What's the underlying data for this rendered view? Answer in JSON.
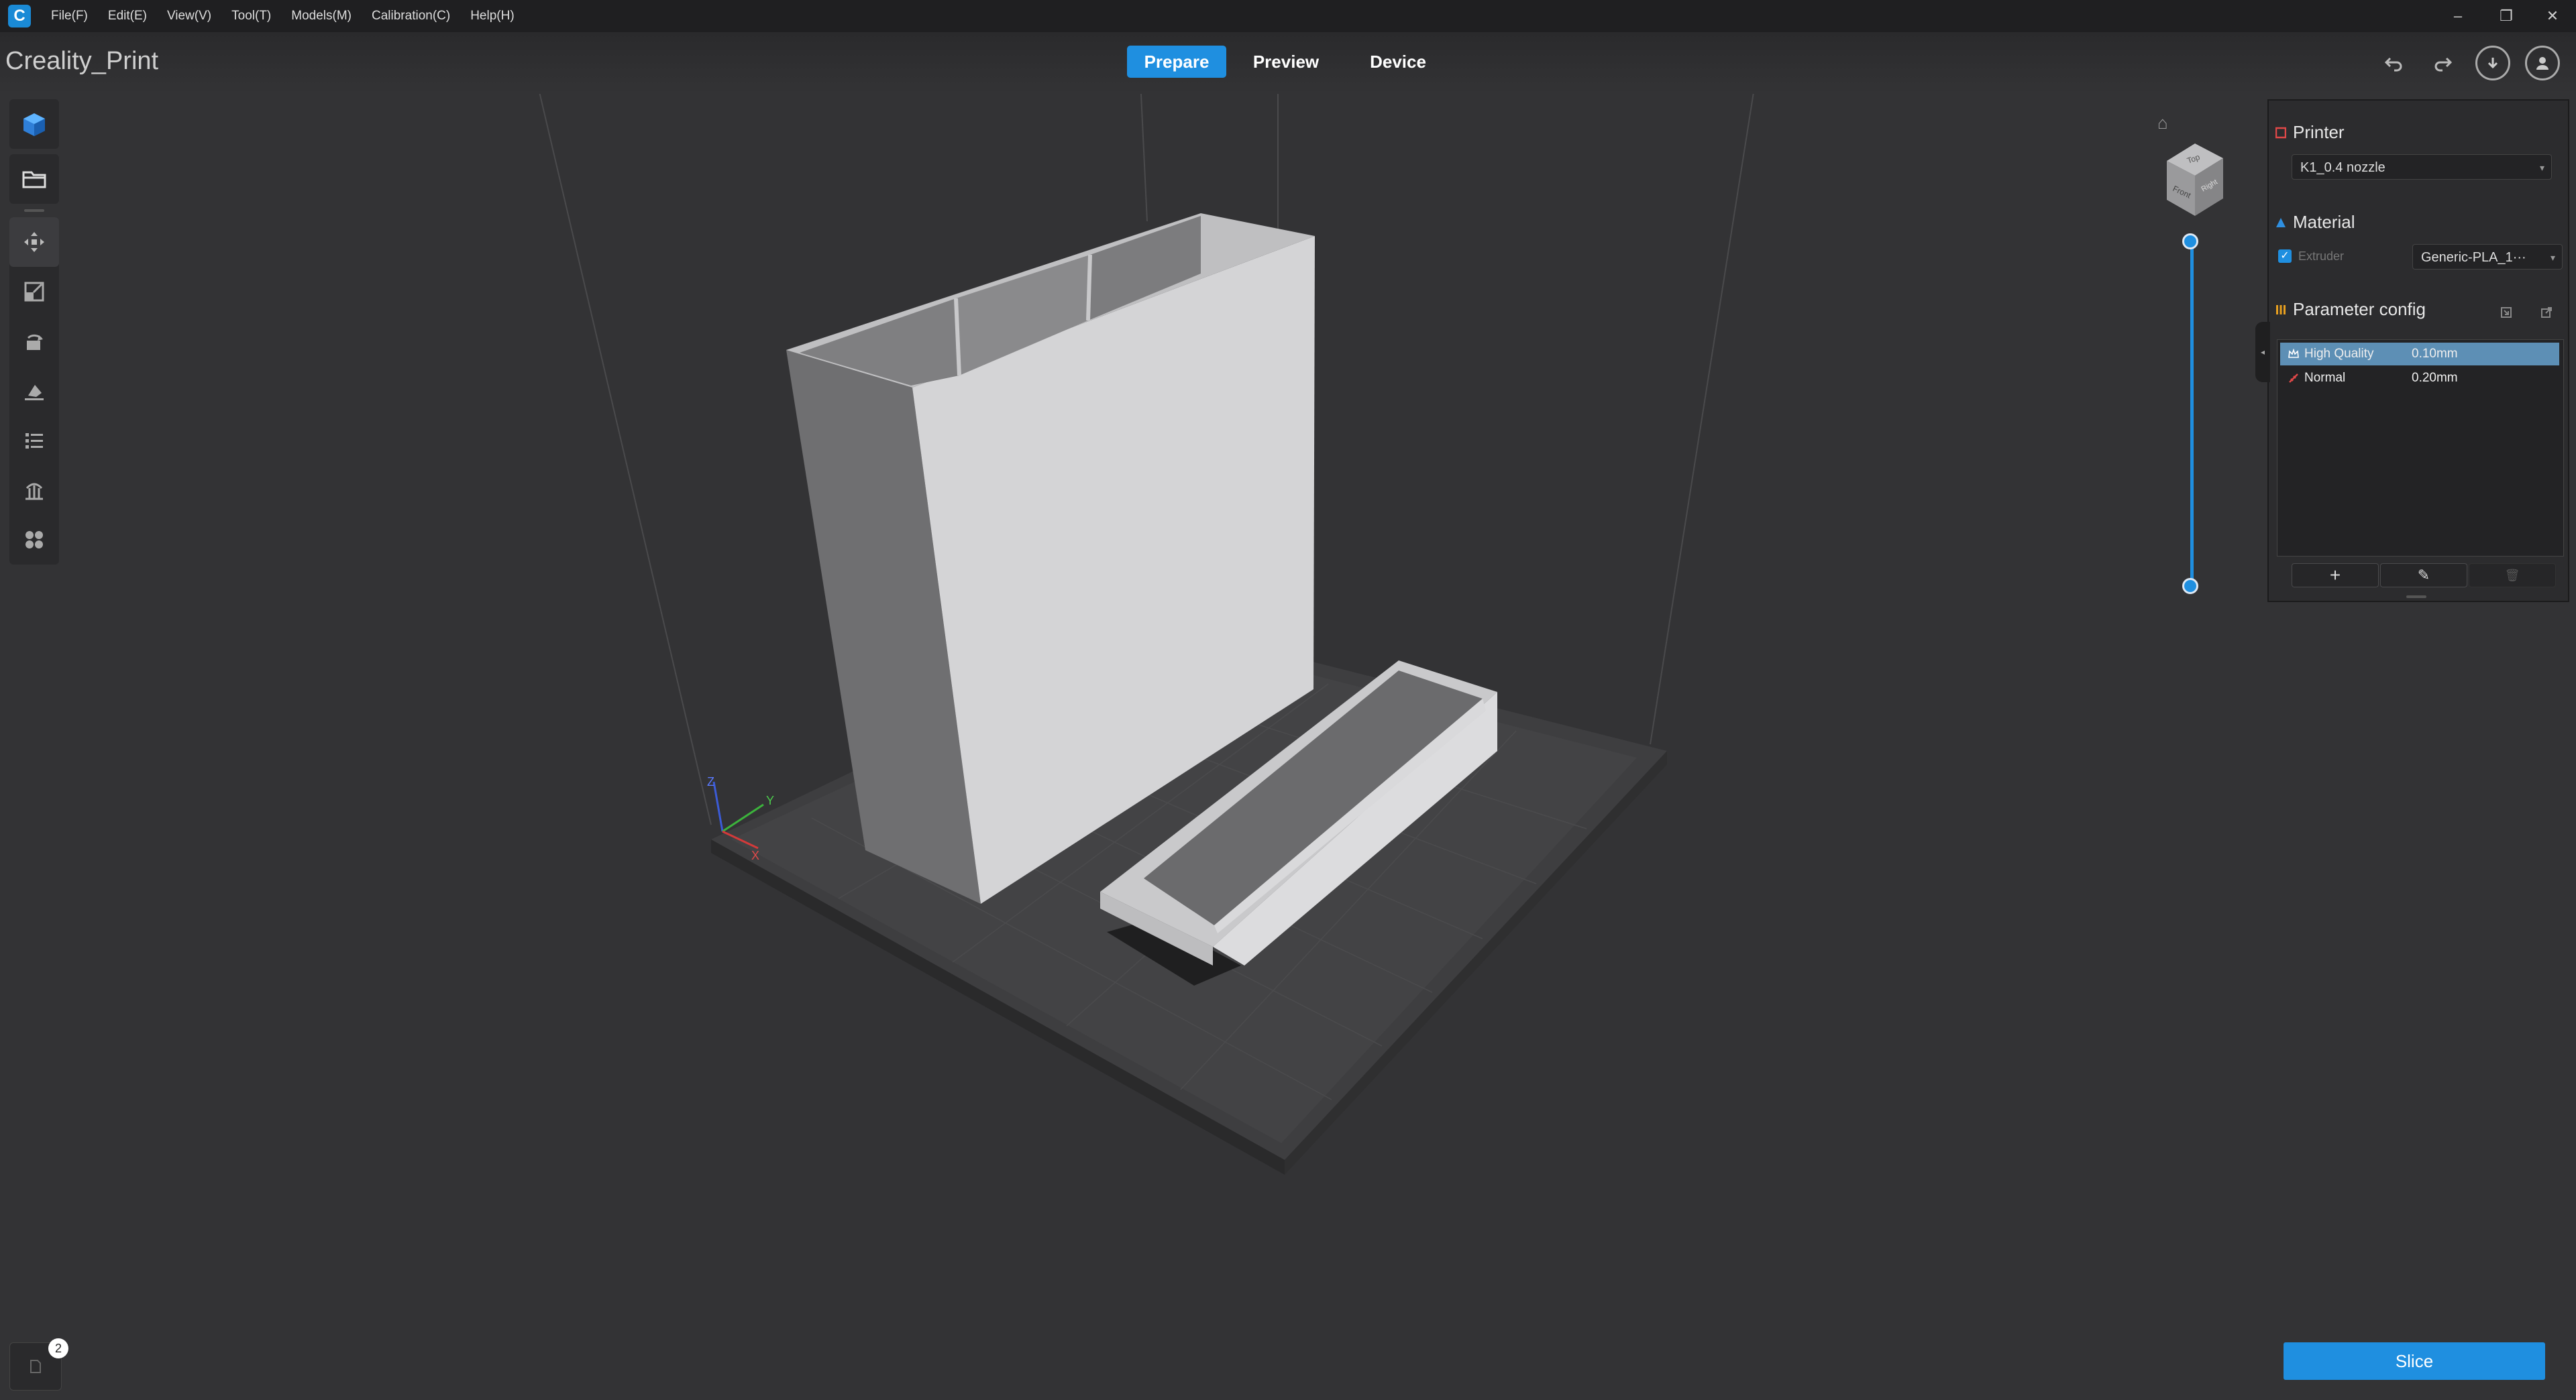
{
  "app": {
    "logo": "creality-logo",
    "logo_glyph": "C",
    "menu": [
      "File(F)",
      "Edit(E)",
      "View(V)",
      "Tool(T)",
      "Models(M)",
      "Calibration(C)",
      "Help(H)"
    ],
    "window_controls": {
      "minimize": "–",
      "restore": "❐",
      "close": "✕"
    }
  },
  "header": {
    "project_title": "Creality_Print",
    "tabs": {
      "prepare": "Prepare",
      "preview": "Preview",
      "device": "Device"
    },
    "active_tab": "Prepare",
    "icons": [
      "undo-icon",
      "redo-icon",
      "download-icon",
      "account-icon"
    ]
  },
  "left_toolbar": {
    "tools": [
      "add-model-icon",
      "open-folder-icon",
      "move-icon",
      "scale-icon",
      "rotate-icon",
      "lay-flat-icon",
      "model-list-icon",
      "support-icon",
      "arrange-icon"
    ]
  },
  "viewport": {
    "viewcube": {
      "top": "Top",
      "front": "Front",
      "right": "Right"
    },
    "axes": {
      "x": "X",
      "y": "Y",
      "z": "Z"
    }
  },
  "right_panel": {
    "printer": {
      "title": "Printer",
      "selected": "K1_0.4 nozzle"
    },
    "material": {
      "title": "Material",
      "extruder_label": "Extruder",
      "extruder_checked": true,
      "selected": "Generic-PLA_1···"
    },
    "parameter_config": {
      "title": "Parameter config",
      "profiles": [
        {
          "name": "High Quality",
          "value": "0.10mm",
          "selected": true
        },
        {
          "name": "Normal",
          "value": "0.20mm",
          "selected": false
        }
      ],
      "buttons": {
        "add": "+",
        "edit": "✎",
        "delete": "🗑"
      }
    }
  },
  "colors": {
    "accent": "#1f8fe0",
    "background": "#333335",
    "panel": "#2c2c2e",
    "selected_row": "#5d8fb5"
  },
  "bottom": {
    "slice_label": "Slice",
    "notification_count": "2"
  }
}
